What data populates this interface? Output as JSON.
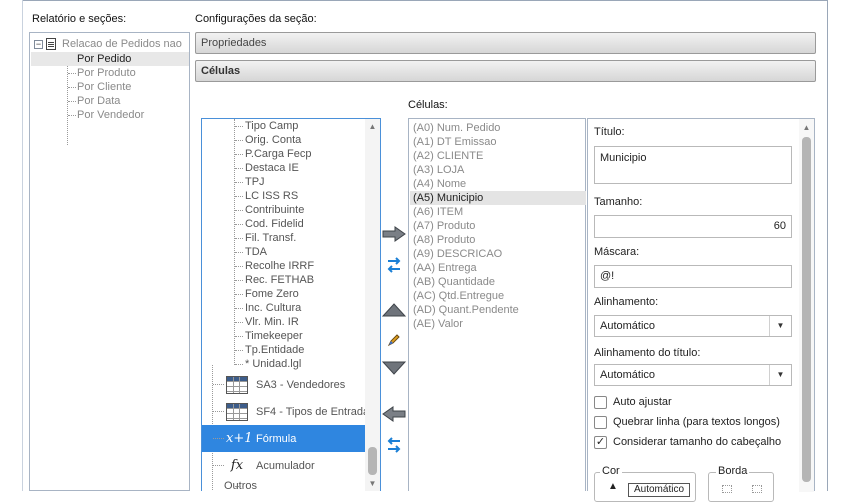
{
  "left_panel": {
    "heading": "Relatório e seções:",
    "root": "Relacao de Pedidos nao",
    "items": [
      "Por Pedido",
      "Por Produto",
      "Por Cliente",
      "Por Data",
      "Por Vendedor"
    ],
    "selected": "Por Pedido"
  },
  "section": {
    "heading": "Configurações da seção:",
    "bars": [
      "Propriedades",
      "Células"
    ]
  },
  "fields": {
    "items": [
      "Tipo Camp",
      "Orig. Conta",
      "P.Carga Fecp",
      "Destaca IE",
      "TPJ",
      "LC ISS RS",
      "Contribuinte",
      "Cod. Fidelid",
      "Fil. Transf.",
      "TDA",
      "Recolhe IRRF",
      "Rec. FETHAB",
      "Fome Zero",
      "Inc. Cultura",
      "Vlr. Min. IR",
      "Timekeeper",
      "Tp.Entidade",
      "* Unidad.lgl"
    ],
    "groups": [
      {
        "label": "SA3 - Vendedores",
        "icon": "table-icon"
      },
      {
        "label": "SF4 - Tipos de Entrada",
        "icon": "table-icon"
      },
      {
        "label": "Fórmula",
        "icon": "formula-icon"
      },
      {
        "label": "Acumulador",
        "icon": "fx-icon"
      }
    ],
    "last_item": "Outros",
    "selected": "Fórmula"
  },
  "actions": [
    "arrow-right-icon",
    "transfer-icon",
    "move-up-icon",
    "edit-icon",
    "move-down-icon",
    "arrow-left-icon",
    "swap-icon"
  ],
  "cells": {
    "heading": "Células:",
    "items": [
      "(A0) Num. Pedido",
      "(A1) DT Emissao",
      "(A2) CLIENTE",
      "(A3) LOJA",
      "(A4) Nome",
      "(A5) Municipio",
      "(A6) ITEM",
      "(A7) Produto",
      "(A8) Produto",
      "(A9) DESCRICAO",
      "(AA) Entrega",
      "(AB) Quantidade",
      "(AC) Qtd.Entregue",
      "(AD) Quant.Pendente",
      "(AE) Valor"
    ],
    "selected": "(A5) Municipio"
  },
  "properties": {
    "titulo_label": "Título:",
    "titulo_value": "Municipio",
    "tamanho_label": "Tamanho:",
    "tamanho_value": "60",
    "mascara_label": "Máscara:",
    "mascara_value": "@!",
    "alinhamento_label": "Alinhamento:",
    "alinhamento_value": "Automático",
    "alinhamento_titulo_label": "Alinhamento do título:",
    "alinhamento_titulo_value": "Automático",
    "auto_ajustar_label": "Auto ajustar",
    "auto_ajustar": false,
    "quebrar_label": "Quebrar linha (para textos longos)",
    "quebrar": false,
    "considerar_label": "Considerar tamanho do cabeçalho",
    "considerar": true,
    "cor_label": "Cor",
    "cor_value": "Automático",
    "borda_label": "Borda"
  }
}
